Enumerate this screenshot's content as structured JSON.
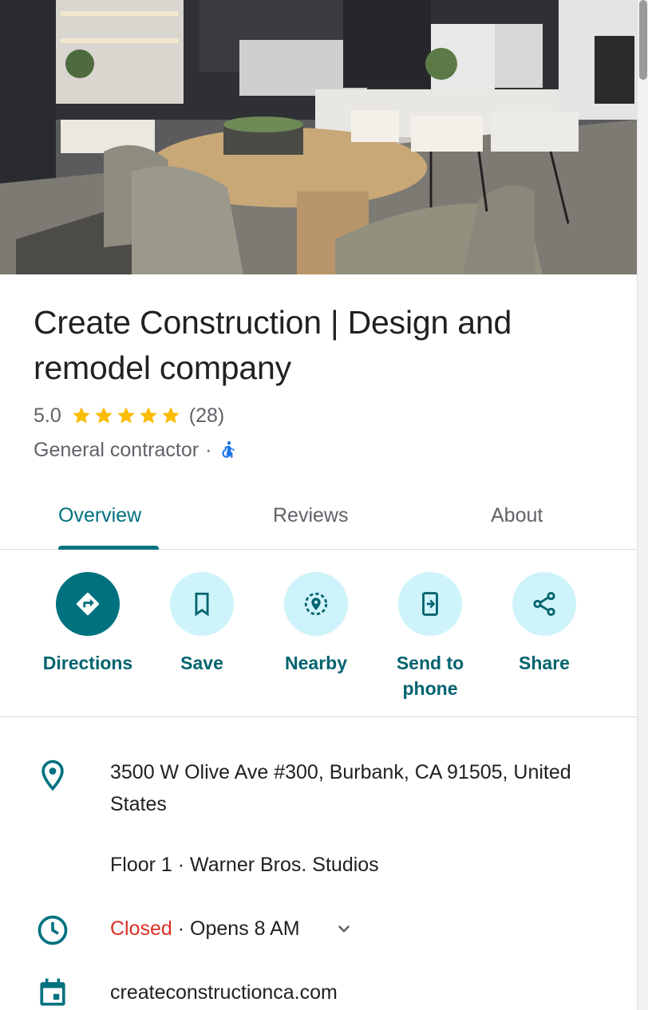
{
  "place": {
    "title": "Create Construction | Design and remodel company",
    "rating": "5.0",
    "stars": 5,
    "review_count": "(28)",
    "category": "General contractor",
    "separator": "·"
  },
  "tabs": [
    {
      "label": "Overview",
      "active": true
    },
    {
      "label": "Reviews",
      "active": false
    },
    {
      "label": "About",
      "active": false
    }
  ],
  "actions": [
    {
      "label": "Directions",
      "icon": "directions-icon"
    },
    {
      "label": "Save",
      "icon": "bookmark-icon"
    },
    {
      "label": "Nearby",
      "icon": "nearby-icon"
    },
    {
      "label": "Send to phone",
      "icon": "send-to-phone-icon"
    },
    {
      "label": "Share",
      "icon": "share-icon"
    }
  ],
  "info": {
    "address": "3500 W Olive Ave #300, Burbank, CA 91505, United States",
    "floor": "Floor 1 · Warner Bros. Studios",
    "hours_status": "Closed",
    "hours_detail": " · Opens 8 AM",
    "website": "createconstructionca.com"
  },
  "colors": {
    "accent": "#00727f",
    "action_bg": "#cff3fa",
    "star": "#fbbc04",
    "closed": "#d93025"
  }
}
